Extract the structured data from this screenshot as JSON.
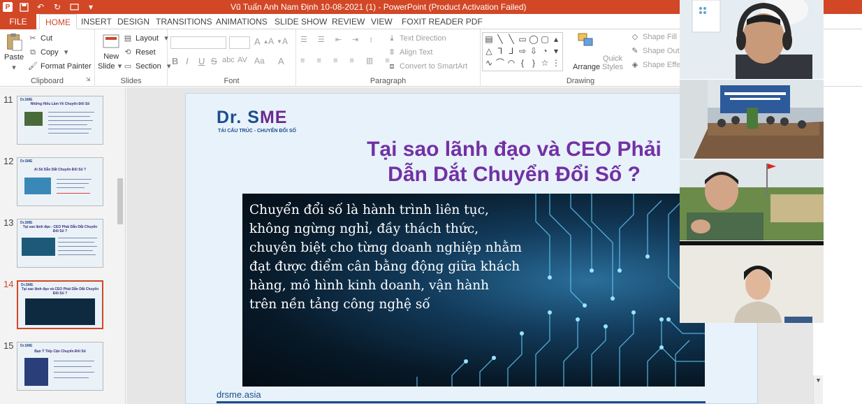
{
  "window": {
    "title": "Vũ Tuấn Anh Nam Định 10-08-2021 (1) -  PowerPoint (Product Activation Failed)"
  },
  "tabs": [
    {
      "label": "FILE"
    },
    {
      "label": "HOME"
    },
    {
      "label": "INSERT"
    },
    {
      "label": "DESIGN"
    },
    {
      "label": "TRANSITIONS"
    },
    {
      "label": "ANIMATIONS"
    },
    {
      "label": "SLIDE SHOW"
    },
    {
      "label": "REVIEW"
    },
    {
      "label": "VIEW"
    },
    {
      "label": "FOXIT READER PDF"
    }
  ],
  "ribbon": {
    "clipboard": {
      "paste": "Paste",
      "cut": "Cut",
      "copy": "Copy",
      "format_painter": "Format Painter",
      "label": "Clipboard"
    },
    "slides": {
      "new_slide_1": "New",
      "new_slide_2": "Slide",
      "layout": "Layout",
      "reset": "Reset",
      "section": "Section",
      "label": "Slides"
    },
    "font": {
      "label": "Font",
      "grow": "A",
      "shrink": "A",
      "clear": "A",
      "bold": "B",
      "italic": "I",
      "underline": "U",
      "strike": "S",
      "spacing": "AV",
      "case": "Aa",
      "color": "A",
      "shadow": "abc"
    },
    "paragraph": {
      "text_direction": "Text Direction",
      "align_text": "Align Text",
      "smartart": "Convert to SmartArt",
      "label": "Paragraph"
    },
    "drawing": {
      "arrange": "Arrange",
      "quick_styles_1": "Quick",
      "quick_styles_2": "Styles",
      "shape_fill": "Shape Fill",
      "shape_outline": "Shape Outli",
      "shape_effects": "Shape Effec",
      "label": "Drawing"
    }
  },
  "thumbnails": [
    {
      "num": "11",
      "title": "Những Hiểu Lầm Về Chuyển Đổi Số"
    },
    {
      "num": "12",
      "title": "Ai Sẽ Dẫn Dắt Chuyển Đổi Số ?"
    },
    {
      "num": "13",
      "title": "Tại sao lãnh đạo - CEO Phải Dẫn Dắt Chuyển Đổi Số ?"
    },
    {
      "num": "14",
      "title": "Tại sao lãnh đạo và CEO Phải Dẫn Dắt Chuyển Đổi Số ?"
    },
    {
      "num": "15",
      "title": "Bạn Ý Tiếp Cận Chuyển Đổi Số"
    }
  ],
  "slide": {
    "logo_text_1": "Dr. S",
    "logo_text_2": "ME",
    "logo_subtitle": "TÁI CẤU TRÚC - CHUYỂN ĐỔI SỐ",
    "title_line1": "Tại sao lãnh đạo và CEO Phải",
    "title_line2": "Dẫn Dắt Chuyển Đổi Số ?",
    "body_lines": [
      "Chuyển đổi số là hành trình liên tục,",
      "không ngừng nghỉ, đầy thách thức,",
      "chuyên biệt cho từng doanh nghiệp nhằm",
      "đạt được điểm cân bằng động giữa khách",
      "hàng, mô hình kinh doanh, vận hành",
      "trên nền tảng công nghệ số"
    ],
    "footer_url": "drsme.asia"
  },
  "colors": {
    "accent": "#d24726",
    "title_purple": "#7231a4",
    "brand_blue": "#1c4e8f"
  }
}
